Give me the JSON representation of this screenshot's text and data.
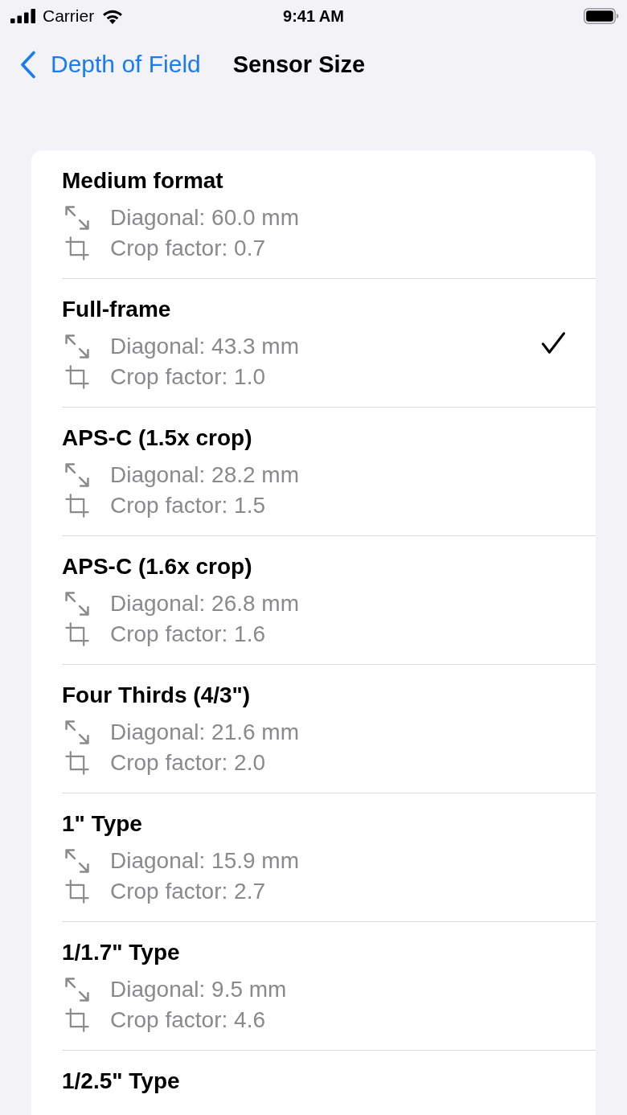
{
  "status_bar": {
    "carrier": "Carrier",
    "time": "9:41 AM"
  },
  "nav": {
    "back": "Depth of Field",
    "title": "Sensor Size"
  },
  "sensors": [
    {
      "name": "Medium format",
      "diagonal": "Diagonal: 60.0 mm",
      "crop": "Crop factor: 0.7",
      "selected": false
    },
    {
      "name": "Full-frame",
      "diagonal": "Diagonal: 43.3 mm",
      "crop": "Crop factor: 1.0",
      "selected": true
    },
    {
      "name": "APS-C (1.5x crop)",
      "diagonal": "Diagonal: 28.2 mm",
      "crop": "Crop factor: 1.5",
      "selected": false
    },
    {
      "name": "APS-C (1.6x crop)",
      "diagonal": "Diagonal: 26.8 mm",
      "crop": "Crop factor: 1.6",
      "selected": false
    },
    {
      "name": "Four Thirds (4/3\")",
      "diagonal": "Diagonal: 21.6 mm",
      "crop": "Crop factor: 2.0",
      "selected": false
    },
    {
      "name": "1\" Type",
      "diagonal": "Diagonal: 15.9 mm",
      "crop": "Crop factor: 2.7",
      "selected": false
    },
    {
      "name": "1/1.7\" Type",
      "diagonal": "Diagonal: 9.5 mm",
      "crop": "Crop factor: 4.6",
      "selected": false
    },
    {
      "name": "1/2.5\" Type",
      "selected": false
    }
  ]
}
